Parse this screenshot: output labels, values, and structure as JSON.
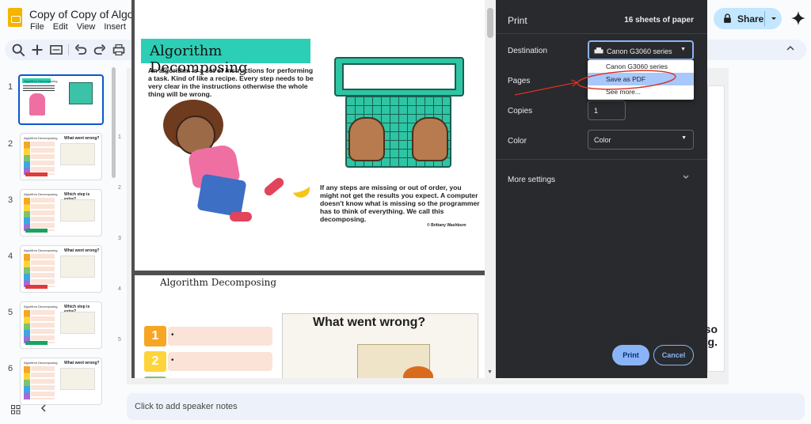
{
  "app": {
    "doc_title": "Copy of Copy of Algori",
    "menu": [
      "File",
      "Edit",
      "View",
      "Insert",
      "F"
    ],
    "share_label": "Share",
    "speaker_notes_placeholder": "Click to add speaker notes"
  },
  "filmstrip": {
    "slides": [
      {
        "num": "1",
        "title": "Algorithm Decomposing",
        "heading": ""
      },
      {
        "num": "2",
        "title": "Algorithm Decomposing",
        "heading": "What went wrong?"
      },
      {
        "num": "3",
        "title": "Algorithm Decomposing",
        "heading": "Which step is extra?"
      },
      {
        "num": "4",
        "title": "Algorithm Decomposing",
        "heading": "What went wrong?"
      },
      {
        "num": "5",
        "title": "Algorithm Decomposing",
        "heading": "Which step is extra?"
      },
      {
        "num": "6",
        "title": "Algorithm Decomposing",
        "heading": "What went wrong?"
      }
    ]
  },
  "ruler": [
    "1",
    "2",
    "3",
    "4",
    "5"
  ],
  "slide_peek_text": "so g.",
  "preview": {
    "page1": {
      "title": "Algorithm Decomposing",
      "body": "An algorithm is a set of instructions for performing a task. Kind of like a recipe. Every step needs to be very clear in the instructions otherwise the whole thing will be wrong.",
      "body2": "If any steps are missing or out of order, you might not get the results you expect. A computer doesn't know what is missing so the programmer has to think of everything. We call this decomposing.",
      "credit": "© Brittany Washburn"
    },
    "page2": {
      "title": "Algorithm Decomposing",
      "nums": [
        "1",
        "2",
        "3"
      ],
      "heading": "What went wrong?"
    }
  },
  "print": {
    "title": "Print",
    "sheets": "16 sheets of paper",
    "destination_label": "Destination",
    "destination_value": "Canon G3060 series",
    "pages_label": "Pages",
    "copies_label": "Copies",
    "copies_value": "1",
    "color_label": "Color",
    "color_value": "Color",
    "more_settings": "More settings",
    "print_button": "Print",
    "cancel_button": "Cancel",
    "dropdown_options": [
      "Canon G3060 series",
      "Save as PDF",
      "See more..."
    ],
    "selected_option": "Save as PDF"
  },
  "colors": {
    "accent": "#8ab4f8",
    "panel_bg": "#292a2d",
    "share_bg": "#c2e7ff",
    "annotation_red": "#d93025",
    "banner_teal": "#2ccfb5"
  }
}
